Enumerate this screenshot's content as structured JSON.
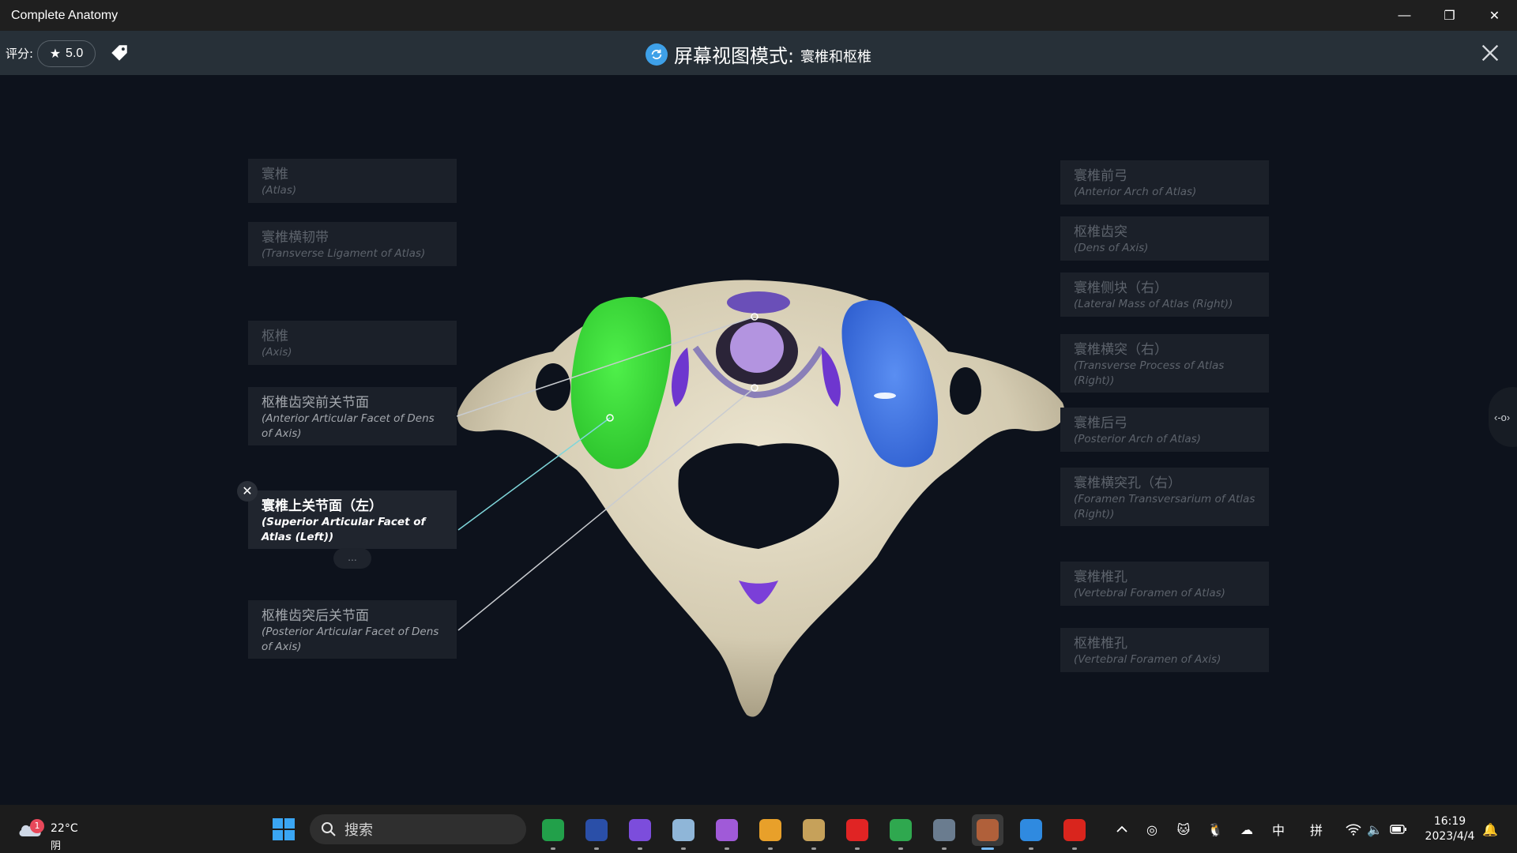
{
  "window": {
    "title": "Complete Anatomy",
    "minimize": "—",
    "maximize": "❐",
    "close": "✕"
  },
  "header": {
    "rating_label": "评分:",
    "rating_value": "5.0",
    "mode_title": "屏幕视图模式:",
    "mode_subtitle": "寰椎和枢椎"
  },
  "labels_left": [
    {
      "cn": "寰椎",
      "en": "(Atlas)",
      "state": "dim"
    },
    {
      "cn": "寰椎横韧带",
      "en": "(Transverse Ligament of Atlas)",
      "state": "dim"
    },
    {
      "cn": "枢椎",
      "en": "(Axis)",
      "state": "dim"
    },
    {
      "cn": "枢椎齿突前关节面",
      "en": "(Anterior Articular Facet of Dens of Axis)",
      "state": "mid"
    },
    {
      "cn": "寰椎上关节面（左）",
      "en": "(Superior Articular Facet of Atlas (Left))",
      "state": "active"
    },
    {
      "cn": "枢椎齿突后关节面",
      "en": "(Posterior Articular Facet of Dens of Axis)",
      "state": "mid"
    }
  ],
  "labels_right": [
    {
      "cn": "寰椎前弓",
      "en": "(Anterior Arch of Atlas)",
      "state": "dim"
    },
    {
      "cn": "枢椎齿突",
      "en": "(Dens of Axis)",
      "state": "dim"
    },
    {
      "cn": "寰椎侧块（右）",
      "en": "(Lateral Mass of Atlas (Right))",
      "state": "dim"
    },
    {
      "cn": "寰椎横突（右）",
      "en": "(Transverse Process of Atlas (Right))",
      "state": "dim"
    },
    {
      "cn": "寰椎后弓",
      "en": "(Posterior Arch of Atlas)",
      "state": "dim"
    },
    {
      "cn": "寰椎横突孔（右）",
      "en": "(Foramen Transversarium of Atlas (Right))",
      "state": "dim"
    },
    {
      "cn": "寰椎椎孔",
      "en": "(Vertebral Foramen of Atlas)",
      "state": "dim"
    },
    {
      "cn": "枢椎椎孔",
      "en": "(Vertebral Foramen of Axis)",
      "state": "dim"
    }
  ],
  "controls": {
    "label_close": "✕",
    "more": "...",
    "side_toggle": "‹-o›"
  },
  "colors": {
    "bone": "#d6cfb8",
    "left_facet": "#3ddc3a",
    "right_facet": "#3e74e4",
    "cartilage": "#7a3ed6",
    "dens": "#b394e0",
    "leader_active": "#7fd6da",
    "leader": "#c9ccd0"
  },
  "taskbar": {
    "weather_temp": "22°C",
    "weather_condition": "阴",
    "weather_badge": "1",
    "search_placeholder": "搜索",
    "apps": [
      {
        "icon": "spreadsheet-app-icon",
        "color": "#22a04a"
      },
      {
        "icon": "cat-game-icon",
        "color": "#2a4fa8"
      },
      {
        "icon": "obsidian-icon",
        "color": "#7c4ddc"
      },
      {
        "icon": "notepad-icon",
        "color": "#8fb6d8"
      },
      {
        "icon": "planet-app-icon",
        "color": "#a05ad8"
      },
      {
        "icon": "g-hub-icon",
        "color": "#e8a02a"
      },
      {
        "icon": "league-icon",
        "color": "#c6a15a"
      },
      {
        "icon": "netease-music-icon",
        "color": "#e02424"
      },
      {
        "icon": "chrome-icon",
        "color": "#2fa84f"
      },
      {
        "icon": "settings-icon",
        "color": "#6a7c8f"
      },
      {
        "icon": "complete-anatomy-icon",
        "color": "#b0603a"
      },
      {
        "icon": "remote-desktop-icon",
        "color": "#2f8ae0"
      },
      {
        "icon": "acrobat-icon",
        "color": "#d9251d"
      }
    ],
    "tray": {
      "ime_lang": "中",
      "ime_mode": "拼"
    },
    "time": "16:19",
    "date": "2023/4/4"
  }
}
